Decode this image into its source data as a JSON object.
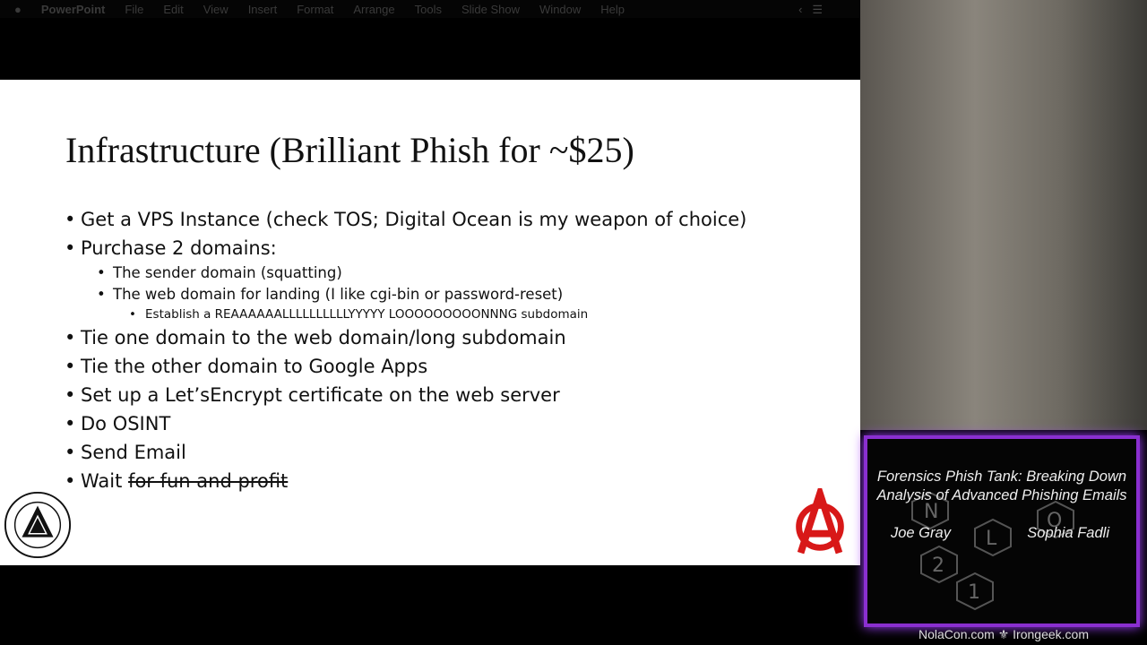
{
  "menubar": {
    "app": "PowerPoint",
    "items": [
      "File",
      "Edit",
      "View",
      "Insert",
      "Format",
      "Arrange",
      "Tools",
      "Slide Show",
      "Window",
      "Help"
    ]
  },
  "slide": {
    "title": "Infrastructure (Brilliant Phish for ~$25)",
    "bullets": [
      "Get a VPS Instance (check TOS; Digital Ocean is my weapon of choice)",
      "Purchase 2 domains:",
      "The sender domain (squatting)",
      "The web domain for landing (I like cgi-bin or password-reset)",
      "Establish a REAAAAAALLLLLLLLLLYYYYY LOOOOOOOOONNNG subdomain",
      "Tie one domain to the web domain/long subdomain",
      "Tie the other domain to Google Apps",
      "Set up a Let’sEncrypt certificate on the web server",
      "Do OSINT",
      "Send Email",
      "Wait"
    ],
    "struck_text": "for fun and profit",
    "logo_left": "VALHALLA INFORMATION SECURITY"
  },
  "overlay": {
    "talk_title": "Forensics Phish Tank: Breaking Down Analysis of Advanced Phishing Emails",
    "speaker1": "Joe Gray",
    "speaker2": "Sophia Fadli",
    "logo": "NOLACON 2019",
    "footer": "NolaCon.com ⚜ Irongeek.com",
    "accent": "#8a2fd0"
  }
}
